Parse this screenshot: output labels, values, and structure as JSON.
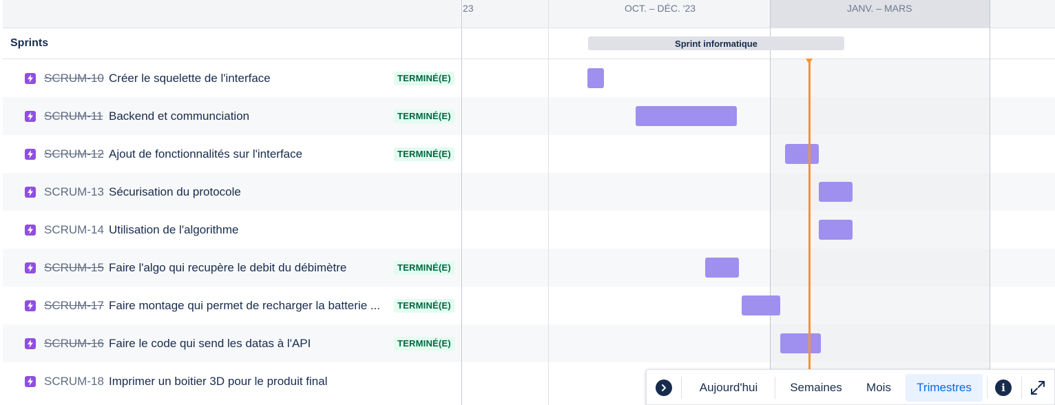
{
  "timeline_header": {
    "col_partial": "23",
    "col_q4": "OCT. – DÉC. '23",
    "col_q1": "JANV. – MARS"
  },
  "sprints": {
    "title": "Sprints",
    "sprint_bar_label": "Sprint informatique"
  },
  "issues": [
    {
      "key": "SCRUM-10",
      "summary": "Créer le squelette de l'interface",
      "status": "TERMINÉ(E)"
    },
    {
      "key": "SCRUM-11",
      "summary": "Backend et communciation",
      "status": "TERMINÉ(E)"
    },
    {
      "key": "SCRUM-12",
      "summary": "Ajout de fonctionnalités sur l'interface",
      "status": "TERMINÉ(E)"
    },
    {
      "key": "SCRUM-13",
      "summary": "Sécurisation du protocole",
      "status": ""
    },
    {
      "key": "SCRUM-14",
      "summary": "Utilisation de l'algorithme",
      "status": ""
    },
    {
      "key": "SCRUM-15",
      "summary": "Faire l'algo qui recupère le debit du débimètre",
      "status": "TERMINÉ(E)"
    },
    {
      "key": "SCRUM-17",
      "summary": "Faire montage qui permet de recharger la batterie ...",
      "status": "TERMINÉ(E)"
    },
    {
      "key": "SCRUM-16",
      "summary": "Faire le code qui send les datas à l'API",
      "status": "TERMINÉ(E)"
    },
    {
      "key": "SCRUM-18",
      "summary": "Imprimer un boitier 3D pour le produit final",
      "status": ""
    }
  ],
  "toolbar": {
    "today": "Aujourd'hui",
    "weeks": "Semaines",
    "months": "Mois",
    "quarters": "Trimestres",
    "info": "i",
    "active_view": "Trimestres"
  },
  "colors": {
    "bar": "#9f8fef",
    "today_line": "#f79233",
    "status_done_bg": "#e3fcef",
    "status_done_text": "#006644",
    "issue_icon": "#904ee2"
  },
  "icons": {
    "issue_type": "lightning-icon",
    "toolbar_toggle": "chevron-right-icon",
    "info": "info-icon",
    "expand": "expand-icon"
  }
}
